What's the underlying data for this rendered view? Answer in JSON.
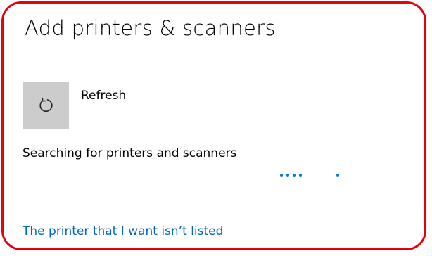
{
  "page": {
    "title": "Add printers & scanners"
  },
  "refresh": {
    "label": "Refresh",
    "icon": "refresh-icon"
  },
  "status": {
    "text": "Searching for printers and scanners",
    "indicator": "indeterminate-progress-dots"
  },
  "link": {
    "text": "The printer that I want isn’t listed"
  },
  "colors": {
    "frame_highlight": "#e8000b",
    "accent": "#0078d7",
    "link": "#0067c0",
    "button_background": "#cccccc"
  }
}
